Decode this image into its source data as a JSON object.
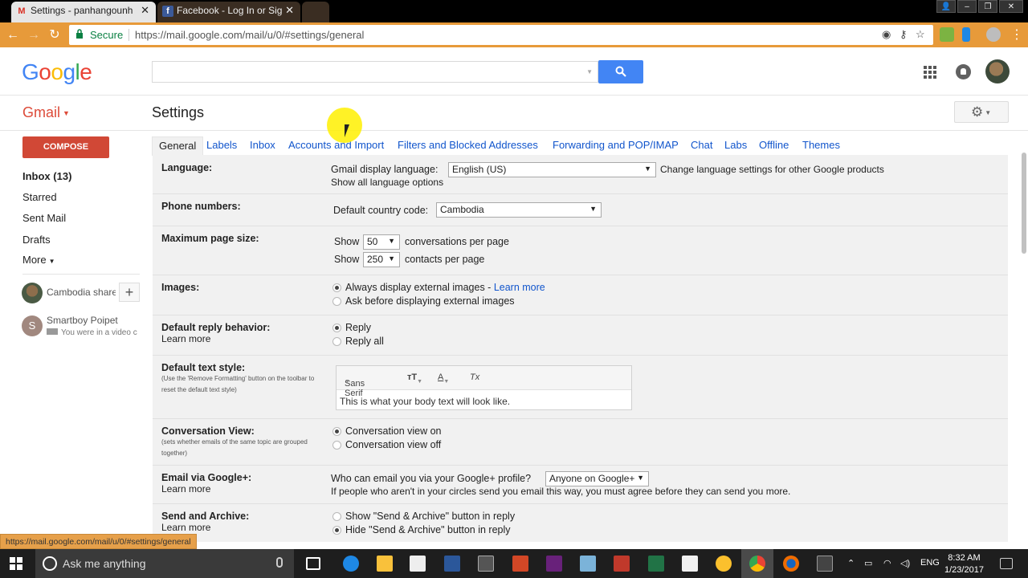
{
  "browser": {
    "tabs": [
      {
        "title": "Settings - panhangounh",
        "favicon": "gmail-icon"
      },
      {
        "title": "Facebook - Log In or Sig",
        "favicon": "facebook-icon"
      }
    ],
    "secure_label": "Secure",
    "url": "https://mail.google.com/mail/u/0/#settings/general",
    "status_url": "https://mail.google.com/mail/u/0/#settings/general",
    "accent_color": "#e79a3a"
  },
  "header": {
    "logo_letters": [
      "G",
      "o",
      "o",
      "g",
      "l",
      "e"
    ],
    "logo_colors": [
      "#4285f4",
      "#ea4335",
      "#fbbc05",
      "#4285f4",
      "#34a853",
      "#ea4335"
    ],
    "search_value": ""
  },
  "gmail": {
    "product_label": "Gmail",
    "page_title": "Settings",
    "compose_label": "COMPOSE",
    "nav": [
      {
        "label": "Inbox (13)",
        "bold": true
      },
      {
        "label": "Starred"
      },
      {
        "label": "Sent Mail"
      },
      {
        "label": "Drafts"
      },
      {
        "label": "More"
      }
    ],
    "hangouts": [
      {
        "name": "Cambodia share",
        "sub": ""
      },
      {
        "name": "Smartboy Poipet",
        "sub": "You were in a video c",
        "initial": "S"
      }
    ]
  },
  "settings_tabs": [
    "General",
    "Labels",
    "Inbox",
    "Accounts and Import",
    "Filters and Blocked Addresses",
    "Forwarding and POP/IMAP",
    "Chat",
    "Labs",
    "Offline",
    "Themes"
  ],
  "settings": {
    "language": {
      "label": "Language:",
      "display_label": "Gmail display language:",
      "display_value": "English (US)",
      "change_link": "Change language settings for other Google products",
      "show_all_link": "Show all language options"
    },
    "phone": {
      "label": "Phone numbers:",
      "country_label": "Default country code:",
      "country_value": "Cambodia"
    },
    "page_size": {
      "label": "Maximum page size:",
      "show": "Show",
      "conversations_value": "50",
      "conversations_suffix": "conversations per page",
      "contacts_value": "250",
      "contacts_suffix": "contacts per page"
    },
    "images": {
      "label": "Images:",
      "opt1": "Always display external images",
      "opt1_sep": " - ",
      "learn_more": "Learn more",
      "opt2": "Ask before displaying external images"
    },
    "reply": {
      "label": "Default reply behavior:",
      "learn_more": "Learn more",
      "opt1": "Reply",
      "opt2": "Reply all"
    },
    "text_style": {
      "label": "Default text style:",
      "sub": "(Use the 'Remove Formatting' button on the toolbar to reset the default text style)",
      "font": "Sans Serif",
      "preview": "This is what your body text will look like."
    },
    "conversation": {
      "label": "Conversation View:",
      "sub": "(sets whether emails of the same topic are grouped together)",
      "opt1": "Conversation view on",
      "opt2": "Conversation view off"
    },
    "gplus": {
      "label": "Email via Google+:",
      "learn_more": "Learn more",
      "question": "Who can email you via your Google+ profile?",
      "value": "Anyone on Google+",
      "note": "If people who aren't in your circles send you email this way, you must agree before they can send you more."
    },
    "send_archive": {
      "label": "Send and Archive:",
      "learn_more": "Learn more",
      "opt1": "Show \"Send & Archive\" button in reply",
      "opt2": "Hide \"Send & Archive\" button in reply"
    }
  },
  "taskbar": {
    "search_placeholder": "Ask me anything",
    "language": "ENG",
    "time": "8:32 AM",
    "date": "1/23/2017"
  }
}
